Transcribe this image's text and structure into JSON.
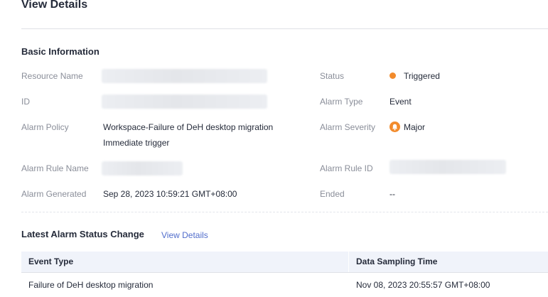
{
  "page": {
    "title": "View Details"
  },
  "basic": {
    "section_title": "Basic Information",
    "resource_name_label": "Resource Name",
    "id_label": "ID",
    "alarm_policy_label": "Alarm Policy",
    "alarm_policy_line1": "Workspace-Failure of DeH desktop migration",
    "alarm_policy_line2": "Immediate trigger",
    "alarm_rule_name_label": "Alarm Rule Name",
    "alarm_generated_label": "Alarm Generated",
    "alarm_generated_value": "Sep 28, 2023 10:59:21 GMT+08:00",
    "status_label": "Status",
    "status_value": "Triggered",
    "status_color": "#f28b2c",
    "alarm_type_label": "Alarm Type",
    "alarm_type_value": "Event",
    "alarm_severity_label": "Alarm Severity",
    "alarm_severity_value": "Major",
    "alarm_severity_icon": "bell-icon",
    "alarm_severity_color": "#f28b2c",
    "alarm_rule_id_label": "Alarm Rule ID",
    "ended_label": "Ended",
    "ended_value": "--"
  },
  "latest": {
    "section_title": "Latest Alarm Status Change",
    "view_details_link": "View Details",
    "columns": [
      "Event Type",
      "Data Sampling Time"
    ],
    "rows": [
      {
        "event_type": "Failure of DeH desktop migration",
        "sampling_time": "Nov 08, 2023 20:55:57 GMT+08:00"
      }
    ]
  },
  "colors": {
    "link": "#526ecc",
    "header_bg": "#f0f3fa"
  }
}
